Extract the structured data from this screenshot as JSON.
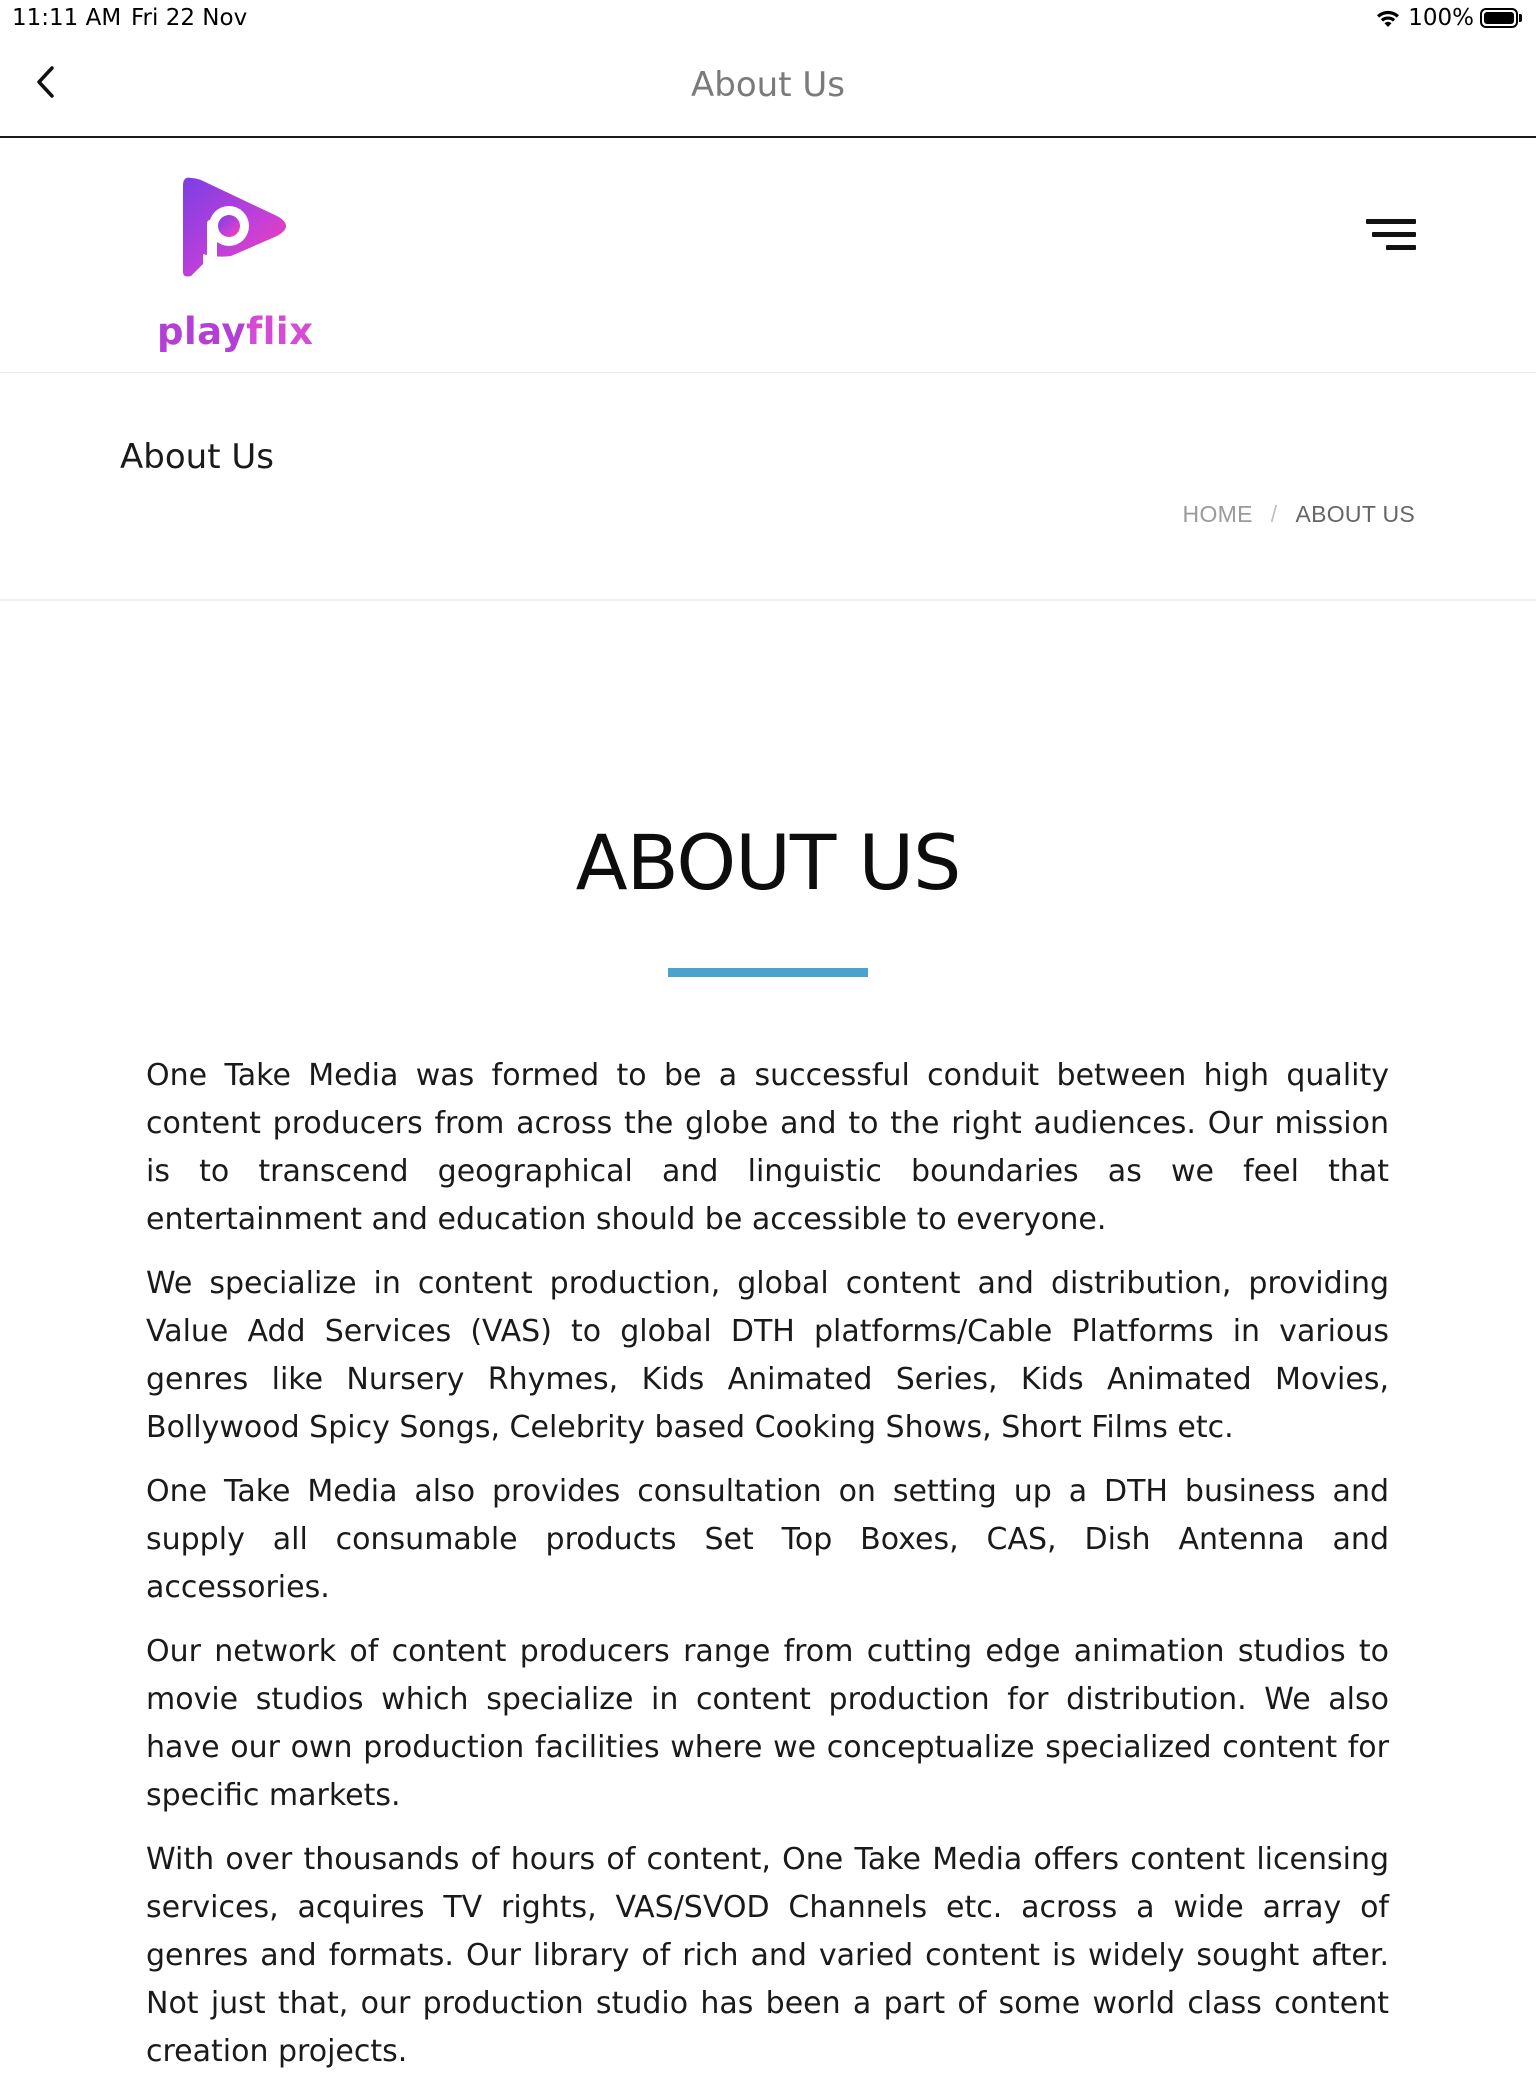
{
  "status_bar": {
    "time": "11:11 AM",
    "date": "Fri 22 Nov",
    "battery": "100%"
  },
  "nav": {
    "title": "About Us",
    "back_icon": "chevron-left-icon"
  },
  "header": {
    "logo_text_1": "play",
    "logo_text_2": "flix",
    "menu_icon": "hamburger-menu-icon",
    "brand_colors": [
      "#7b3fe4",
      "#d23fd6",
      "#ff3fa0"
    ]
  },
  "page_title_bar": {
    "title": "About Us",
    "breadcrumb": {
      "home": "HOME",
      "separator": "/",
      "current": "ABOUT US"
    }
  },
  "main": {
    "heading": "ABOUT US",
    "accent_color": "#4aa3cc",
    "paragraphs": [
      "One Take Media was formed to be a successful conduit between high quality content producers from across the globe and to the right audiences. Our mission is to transcend geographical and linguistic boundaries as we feel that entertainment and education should be accessible to everyone.",
      "We specialize in content production, global content and distribution, providing Value Add Services (VAS) to global DTH platforms/Cable Platforms in various genres like Nursery Rhymes, Kids Animated Series, Kids Animated Movies, Bollywood Spicy Songs, Celebrity based Cooking Shows, Short Films etc.",
      "One Take Media also provides consultation on setting up a DTH business and supply all consumable products Set Top Boxes, CAS, Dish Antenna and accessories.",
      "Our network of content producers range from cutting edge animation studios to movie studios which specialize in content production for distribution. We also have our own production facilities where we conceptualize specialized content for specific markets.",
      "With over thousands of hours of content, One Take Media offers content licensing services, acquires TV rights, VAS/SVOD Channels etc. across a wide array of genres and formats. Our library of rich and varied content is widely sought after. Not just that, our production studio has been a part of some world class content creation projects."
    ]
  }
}
